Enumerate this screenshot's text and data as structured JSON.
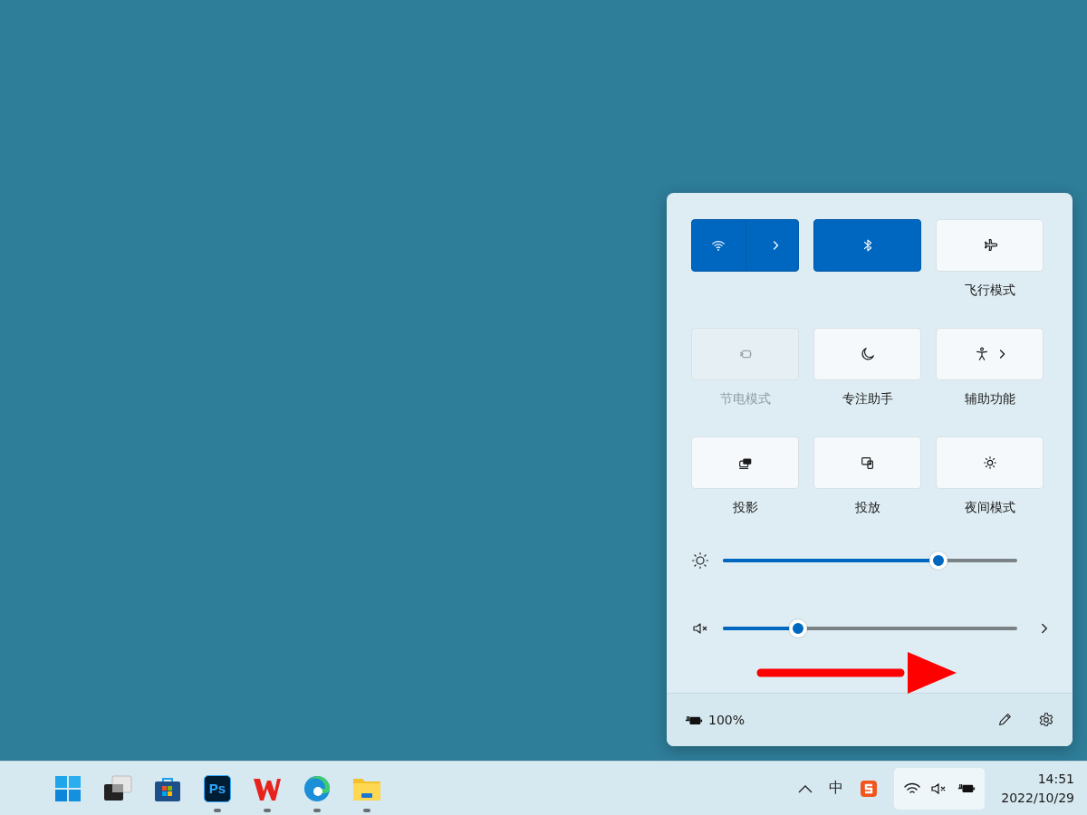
{
  "quick_settings": {
    "tiles": [
      {
        "on": true,
        "disabled": false,
        "expandable": true
      },
      {
        "on": true,
        "disabled": false,
        "expandable": false
      },
      {
        "label": "飞行模式",
        "on": false,
        "disabled": false,
        "expandable": false
      },
      {
        "label": "节电模式",
        "on": false,
        "disabled": true,
        "expandable": false
      },
      {
        "label": "专注助手",
        "on": false,
        "disabled": false,
        "expandable": false
      },
      {
        "label": "辅助功能",
        "on": false,
        "disabled": false,
        "expandable": true
      },
      {
        "label": "投影",
        "on": false,
        "disabled": false,
        "expandable": false
      },
      {
        "label": "投放",
        "on": false,
        "disabled": false,
        "expandable": false
      },
      {
        "label": "夜间模式",
        "on": false,
        "disabled": false,
        "expandable": false
      }
    ],
    "sliders": [
      {
        "kind": "brightness",
        "level": 0.69,
        "expandable": false
      },
      {
        "kind": "volume",
        "level": 0.24,
        "muted": true,
        "expandable": true
      }
    ],
    "battery": "100%"
  },
  "taskbar": {
    "apps": [
      {
        "running": false
      },
      {
        "running": false
      },
      {
        "running": false
      },
      {
        "running": true,
        "label": "Ps"
      },
      {
        "running": true
      },
      {
        "running": true
      },
      {
        "running": true
      }
    ],
    "input_method": "中",
    "time": "14:51",
    "date": "2022/10/29"
  }
}
